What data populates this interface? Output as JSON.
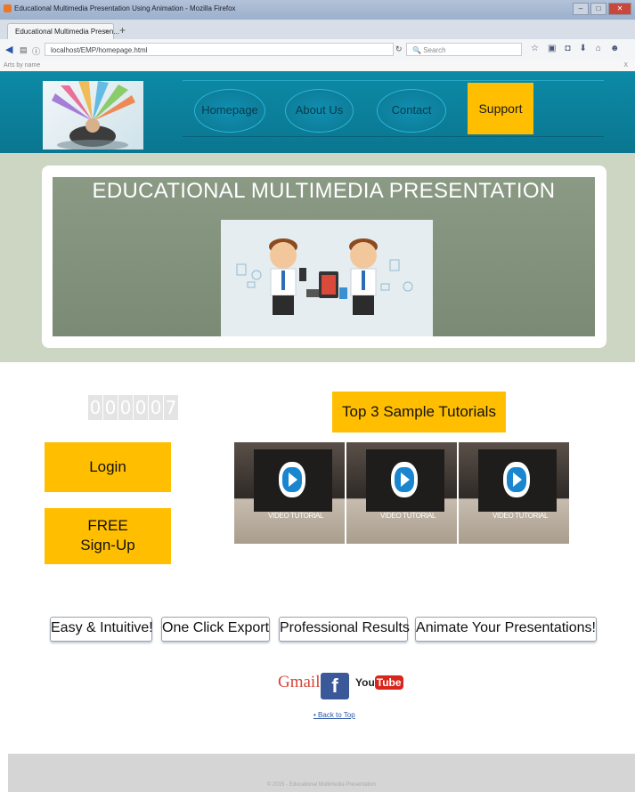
{
  "browser": {
    "window_title": "Educational Multimedia Presentation Using Animation - Mozilla Firefox",
    "tab_title": "Educational Multimedia Presen...",
    "tab_close": "×",
    "new_tab": "+",
    "url": "localhost/EMP/homepage.html",
    "search_placeholder": "Search",
    "find_text": "Arts by name",
    "find_close": "X"
  },
  "nav": {
    "homepage": "Homepage",
    "about": "About Us",
    "contact": "Contact",
    "support": "Support"
  },
  "banner": {
    "title": "EDUCATIONAL MULTIMEDIA PRESENTATION"
  },
  "counter": {
    "digits": [
      "0",
      "0",
      "0",
      "0",
      "0",
      "7"
    ]
  },
  "actions": {
    "login": "Login",
    "signup_line1": "FREE",
    "signup_line2": "Sign-Up"
  },
  "tutorials": {
    "title": "Top 3 Sample Tutorials",
    "items": [
      {
        "caption": "VIDEO TUTORIAL"
      },
      {
        "caption": "VIDEO TUTORIAL"
      },
      {
        "caption": "VIDEO TUTORIAL"
      }
    ]
  },
  "features": [
    "Easy & Intuitive!",
    "One Click Export",
    "Professional Results",
    "Animate Your Presentations!"
  ],
  "social": {
    "gmail": "Gmail",
    "facebook": "f",
    "youtube_you": "You",
    "youtube_tube": "Tube"
  },
  "back_to_top": "Back to Top",
  "colors": {
    "header": "#0c8aa6",
    "accent_yellow": "#ffbf00",
    "banner_bg": "#cdd6c3"
  }
}
